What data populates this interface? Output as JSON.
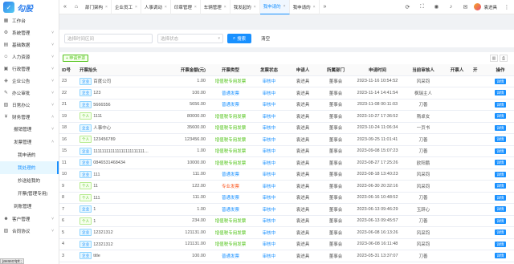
{
  "brand": {
    "name": "勾股",
    "sub": "OA"
  },
  "sidebar": {
    "items": [
      {
        "label": "工作台",
        "icon": "dashboard-icon"
      },
      {
        "label": "系统管理",
        "icon": "gear-icon"
      },
      {
        "label": "基础数据",
        "icon": "database-icon"
      },
      {
        "label": "人力资源",
        "icon": "people-icon"
      },
      {
        "label": "行政管理",
        "icon": "briefcase-icon"
      },
      {
        "label": "企业公告",
        "icon": "megaphone-icon"
      },
      {
        "label": "办公审批",
        "icon": "approval-icon"
      },
      {
        "label": "日常办公",
        "icon": "calendar-icon"
      },
      {
        "label": "财务管理",
        "icon": "money-icon"
      }
    ],
    "finance_sub": [
      {
        "label": "报销管理"
      },
      {
        "label": "发票管理"
      }
    ],
    "invoice_sub": [
      {
        "label": "我申请的"
      },
      {
        "label": "我处理的"
      },
      {
        "label": "抄送给我的"
      },
      {
        "label": "开票(管理专用)"
      }
    ],
    "tail_items": [
      {
        "label": "到账管理",
        "indent": true
      },
      {
        "label": "客户管理",
        "icon": "customer-icon"
      },
      {
        "label": "合同协议",
        "icon": "contract-icon"
      }
    ]
  },
  "status_bar": "javascript:;",
  "topbar": {
    "tabs": [
      {
        "label": "部门架构"
      },
      {
        "label": "企业员工"
      },
      {
        "label": "人事调动"
      },
      {
        "label": "印章管理"
      },
      {
        "label": "车辆管理"
      },
      {
        "label": "我发起的"
      },
      {
        "label": "我申请的"
      },
      {
        "label": "我申请的"
      }
    ],
    "user": "袁进具"
  },
  "filter": {
    "keyword_placeholder": "选择时间区间",
    "status_placeholder": "选择状态",
    "search_label": "搜索",
    "clear_label": "清空"
  },
  "toolbar": {
    "add_label": "+ 申请开票"
  },
  "table": {
    "headers": [
      "ID号",
      "开票抬头",
      "开票金额(元)",
      "开票类型",
      "发票状态",
      "申请人",
      "所属部门",
      "申请时间",
      "当前审核人",
      "开票人",
      "开",
      "操作"
    ],
    "detail_label": "详情",
    "rows": [
      {
        "id": "23",
        "tag": "企业",
        "tag_type": "company",
        "title": "百度公司",
        "amount": "1.00",
        "type": "增值税专用发票",
        "type_cls": "special",
        "status": "审核中",
        "applicant": "袁进具",
        "dept": "董事会",
        "time": "2023-11-16 10:54:52",
        "reviewer": "风采钧"
      },
      {
        "id": "22",
        "tag": "企业",
        "tag_type": "company",
        "title": "123",
        "amount": "100.00",
        "type": "普通发票",
        "type_cls": "normal",
        "status": "审核中",
        "applicant": "袁进具",
        "dept": "董事会",
        "time": "2023-11-14 14:41:54",
        "reviewer": "枫瑞主人"
      },
      {
        "id": "21",
        "tag": "企业",
        "tag_type": "company",
        "title": "5666556",
        "amount": "5656.00",
        "type": "普通发票",
        "type_cls": "normal",
        "status": "审核中",
        "applicant": "袁进具",
        "dept": "董事会",
        "time": "2023-11-08 00:11:03",
        "reviewer": "刀善"
      },
      {
        "id": "19",
        "tag": "个人",
        "tag_type": "person",
        "title": "1111",
        "amount": "80000.00",
        "type": "增值税专用发票",
        "type_cls": "special",
        "status": "审核中",
        "applicant": "袁进具",
        "dept": "董事会",
        "time": "2023-10-27 17:36:52",
        "reviewer": "隋卓女"
      },
      {
        "id": "18",
        "tag": "企业",
        "tag_type": "company",
        "title": "人事中心",
        "amount": "35600.00",
        "type": "增值税专用发票",
        "type_cls": "special",
        "status": "审核中",
        "applicant": "袁进具",
        "dept": "董事会",
        "time": "2023-10-24 11:06:34",
        "reviewer": "一页书"
      },
      {
        "id": "16",
        "tag": "个人",
        "tag_type": "person",
        "title": "123456789",
        "amount": "123456.00",
        "type": "增值税专用发票",
        "type_cls": "special",
        "status": "审核中",
        "applicant": "袁进具",
        "dept": "董事会",
        "time": "2023-09-25 11:01:41",
        "reviewer": "刀善"
      },
      {
        "id": "15",
        "tag": "企业",
        "tag_type": "company",
        "title": "111111111111111111111111...",
        "amount": "1.00",
        "type": "增值税专用发票",
        "type_cls": "special",
        "status": "审核中",
        "applicant": "袁进具",
        "dept": "董事会",
        "time": "2023-09-08 15:07:23",
        "reviewer": "刀善"
      },
      {
        "id": "11",
        "tag": "企业",
        "tag_type": "company",
        "title": "0846531468434",
        "amount": "10000.00",
        "type": "增值税专用发票",
        "type_cls": "special",
        "status": "审核中",
        "applicant": "袁进具",
        "dept": "董事会",
        "time": "2023-08-27 17:25:26",
        "reviewer": "欧阳鹏"
      },
      {
        "id": "10",
        "tag": "企业",
        "tag_type": "company",
        "title": "111",
        "amount": "111.00",
        "type": "普通发票",
        "type_cls": "normal",
        "status": "审核中",
        "applicant": "袁进具",
        "dept": "董事会",
        "time": "2023-08-18 13:40:23",
        "reviewer": "风采钧"
      },
      {
        "id": "9",
        "tag": "个人",
        "tag_type": "person",
        "title": "11",
        "amount": "122.00",
        "type": "专业发票",
        "type_cls": "pro",
        "status": "审核中",
        "applicant": "袁进具",
        "dept": "董事会",
        "time": "2023-06-30 20:32:16",
        "reviewer": "风采钧"
      },
      {
        "id": "8",
        "tag": "个人",
        "tag_type": "person",
        "title": "111",
        "amount": "111.00",
        "type": "普通发票",
        "type_cls": "normal",
        "status": "审核中",
        "applicant": "袁进具",
        "dept": "董事会",
        "time": "2023-06-16 10:48:52",
        "reviewer": "刀善"
      },
      {
        "id": "7",
        "tag": "企业",
        "tag_type": "company",
        "title": "1",
        "amount": "1.00",
        "type": "普通发票",
        "type_cls": "normal",
        "status": "审核中",
        "applicant": "袁进具",
        "dept": "董事会",
        "time": "2023-06-13 09:46:29",
        "reviewer": "玉辞心"
      },
      {
        "id": "6",
        "tag": "个人",
        "tag_type": "person",
        "title": "1",
        "amount": "234.00",
        "type": "增值税专用发票",
        "type_cls": "special",
        "status": "审核中",
        "applicant": "袁进具",
        "dept": "董事会",
        "time": "2023-06-13 09:45:57",
        "reviewer": "刀善"
      },
      {
        "id": "5",
        "tag": "企业",
        "tag_type": "company",
        "title": "12321312",
        "amount": "121131.00",
        "type": "增值税专用发票",
        "type_cls": "special",
        "status": "审核中",
        "applicant": "袁进具",
        "dept": "董事会",
        "time": "2023-06-08 16:13:26",
        "reviewer": "风采钧"
      },
      {
        "id": "4",
        "tag": "企业",
        "tag_type": "company",
        "title": "12321312",
        "amount": "121131.00",
        "type": "增值税专用发票",
        "type_cls": "special",
        "status": "审核中",
        "applicant": "袁进具",
        "dept": "董事会",
        "time": "2023-06-08 16:11:48",
        "reviewer": "风采钧"
      },
      {
        "id": "3",
        "tag": "企业",
        "tag_type": "company",
        "title": "title",
        "amount": "100.00",
        "type": "普通发票",
        "type_cls": "normal",
        "status": "审核中",
        "applicant": "袁进具",
        "dept": "董事会",
        "time": "2023-05-31 13:37:07",
        "reviewer": "刀善"
      }
    ]
  }
}
